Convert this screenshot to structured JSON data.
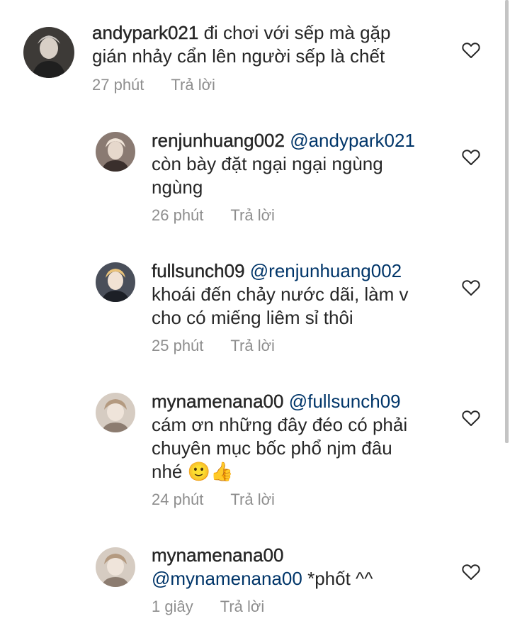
{
  "comments": [
    {
      "username": "andypark021",
      "mention": "",
      "text_lines": [
        "đi chơi với sếp mà gặp",
        "gián nhảy cẩn lên người sếp là chết"
      ],
      "time": "27 phút",
      "reply_label": "Trả lời",
      "avatar_color": "#2b2b2b"
    },
    {
      "username": "renjunhuang002",
      "mention": "@andypark021",
      "text_lines": [
        "còn bày đặt ngại ngại ngùng",
        "ngùng"
      ],
      "time": "26 phút",
      "reply_label": "Trả lời",
      "avatar_color": "#6b5a55"
    },
    {
      "username": "fullsunch09",
      "mention": "@renjunhuang002",
      "text_lines": [
        "khoái đến chảy nước dãi, làm v",
        "cho có miếng liêm sỉ thôi"
      ],
      "time": "25 phút",
      "reply_label": "Trả lời",
      "avatar_color": "#3a3f4a"
    },
    {
      "username": "mynamenana00",
      "mention": "@fullsunch09",
      "text_lines": [
        "cám ơn những đây đéo có phải",
        "chuyên mục bốc phổ njm đâu",
        "nhé 🙂👍"
      ],
      "time": "24 phút",
      "reply_label": "Trả lời",
      "avatar_color": "#a89a8c"
    },
    {
      "username": "mynamenana00",
      "mention": "@mynamenana00",
      "text_lines": [
        "*phốt ^^"
      ],
      "time": "1 giây",
      "reply_label": "Trả lời",
      "avatar_color": "#a89a8c"
    }
  ],
  "colors": {
    "text": "#262626",
    "mention": "#003569",
    "meta": "#8e8e8e"
  },
  "icons": {
    "like": "heart-outline-icon"
  }
}
